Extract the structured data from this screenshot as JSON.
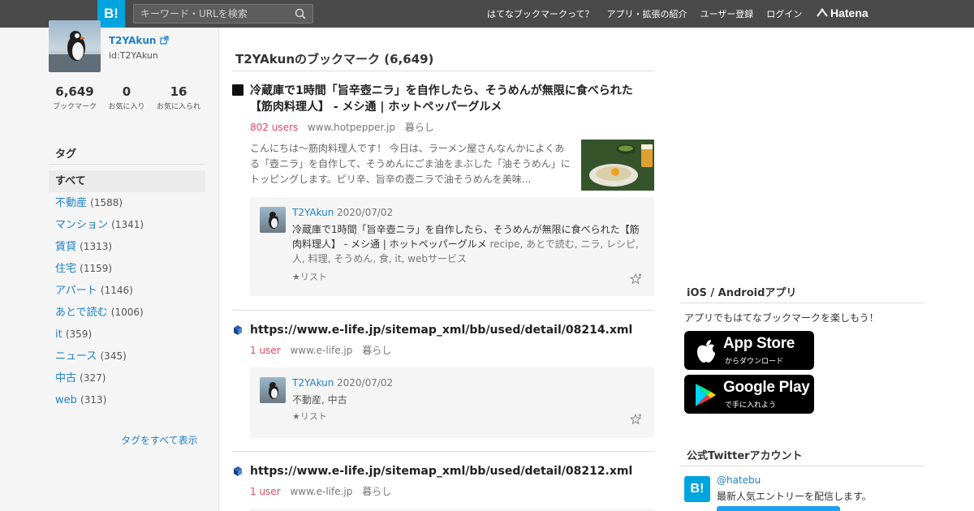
{
  "header": {
    "logo": "B!",
    "search_placeholder": "キーワード・URLを検索",
    "nav": [
      "はてなブックマークって？",
      "アプリ・拡張の紹介",
      "ユーザー登録",
      "ログイン"
    ],
    "brand": "Hatena"
  },
  "profile": {
    "name": "T2YAkun",
    "id": "id:T2YAkun",
    "stats": [
      {
        "value": "6,649",
        "label": "ブックマーク"
      },
      {
        "value": "0",
        "label": "お気に入り"
      },
      {
        "value": "16",
        "label": "お気に入られ"
      }
    ]
  },
  "tags": {
    "heading": "タグ",
    "all": "すべて",
    "items": [
      {
        "name": "不動産",
        "count": "(1588)"
      },
      {
        "name": "マンション",
        "count": "(1341)"
      },
      {
        "name": "賃貸",
        "count": "(1313)"
      },
      {
        "name": "住宅",
        "count": "(1159)"
      },
      {
        "name": "アパート",
        "count": "(1146)"
      },
      {
        "name": "あとで読む",
        "count": "(1006)"
      },
      {
        "name": "it",
        "count": "(359)"
      },
      {
        "name": "ニュース",
        "count": "(345)"
      },
      {
        "name": "中古",
        "count": "(327)"
      },
      {
        "name": "web",
        "count": "(313)"
      }
    ],
    "show_all": "タグをすべて表示"
  },
  "main": {
    "title": "T2YAkunのブックマーク (6,649)",
    "entries": [
      {
        "title": "冷蔵庫で1時間「旨辛壺ニラ」を自作したら、そうめんが無限に食べられた【筋肉料理人】 - メシ通 | ホットペッパーグルメ",
        "users": "802 users",
        "domain": "www.hotpepper.jp",
        "category": "暮らし",
        "summary": "こんにちは～筋肉料理人です！ 今日は、ラーメン屋さんなんかによくある「壺ニラ」を自作して、そうめんにごま油をまぶした「油そうめん」にトッピングします。ピリ辛、旨辛の壺ニラで油そうめんを美味...",
        "bm_user": "T2YAkun",
        "bm_date": "2020/07/02",
        "bm_comment": "冷蔵庫で1時間「旨辛壺ニラ」を自作したら、そうめんが無限に食べられた【筋肉料理人】 - メシ通 | ホットペッパーグルメ",
        "bm_tags": "recipe, あとで読む, ニラ, レシピ, 人, 料理, そうめん, 食, it, webサービス",
        "list": "★リスト"
      },
      {
        "title": "https://www.e-life.jp/sitemap_xml/bb/used/detail/08214.xml",
        "users": "1 user",
        "domain": "www.e-life.jp",
        "category": "暮らし",
        "bm_user": "T2YAkun",
        "bm_date": "2020/07/02",
        "bm_tags": "不動産, 中古",
        "list": "★リスト"
      },
      {
        "title": "https://www.e-life.jp/sitemap_xml/bb/used/detail/08212.xml",
        "users": "1 user",
        "domain": "www.e-life.jp",
        "category": "暮らし"
      }
    ]
  },
  "sidebar": {
    "apps_heading": "iOS / Androidアプリ",
    "apps_text": "アプリでもはてなブックマークを楽しもう！",
    "app_store": {
      "name": "App Store",
      "sub": "からダウンロード"
    },
    "google_play": {
      "name": "Google Play",
      "sub": "で手に入れよう"
    },
    "twitter_heading": "公式Twitterアカウント",
    "twitter_logo": "B!",
    "twitter_handle": "@hatebu",
    "twitter_desc": "最新人気エントリーを配信します。"
  },
  "colors": {
    "header_bg": "#4a4a4a",
    "brand_blue": "#00a4de",
    "link_blue": "#2081c9",
    "users_red": "#e9455d"
  }
}
